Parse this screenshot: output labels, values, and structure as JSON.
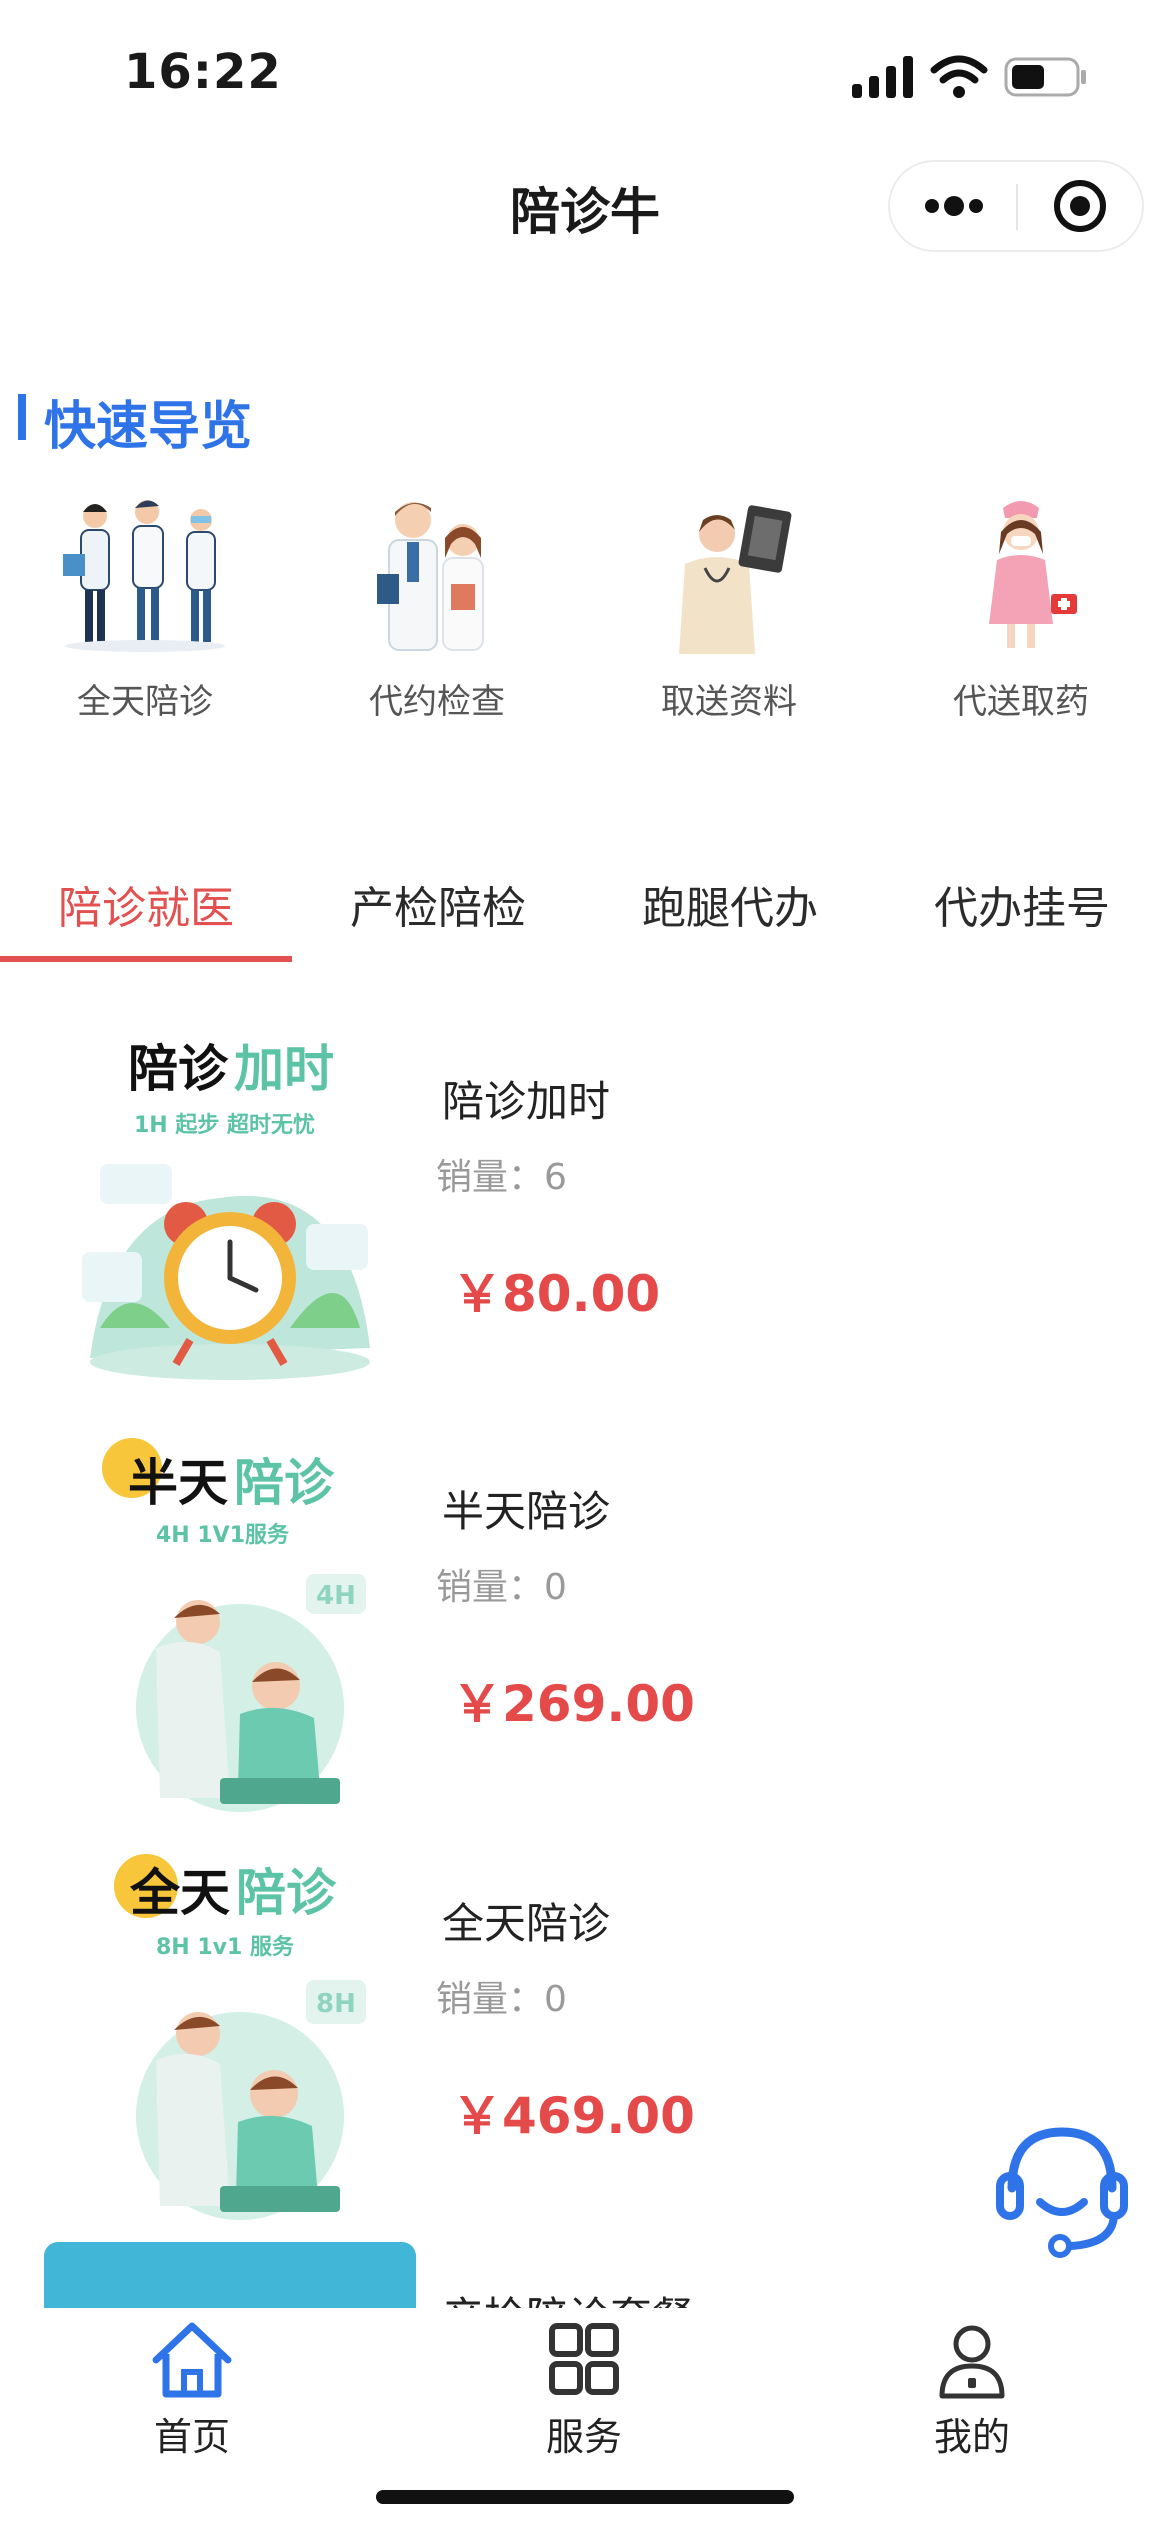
{
  "status": {
    "time": "16:22"
  },
  "nav": {
    "title": "陪诊牛"
  },
  "quick_nav": {
    "title": "快速导览",
    "items": [
      {
        "label": "全天陪诊",
        "icon": "doctors-group-illustration"
      },
      {
        "label": "代约检查",
        "icon": "doctor-nurse-illustration"
      },
      {
        "label": "取送资料",
        "icon": "doctor-xray-illustration"
      },
      {
        "label": "代送取药",
        "icon": "nurse-girl-medkit-illustration"
      }
    ]
  },
  "tabs": {
    "items": [
      {
        "label": "陪诊就医",
        "active": true
      },
      {
        "label": "产检陪检",
        "active": false
      },
      {
        "label": "跑腿代办",
        "active": false
      },
      {
        "label": "代办挂号",
        "active": false
      }
    ]
  },
  "products": [
    {
      "name": "陪诊加时",
      "sales": "销量：6",
      "price": "￥80.00",
      "thumb": {
        "title_a": "陪诊",
        "title_b": "加时",
        "subtitle": "1H 起步 超时无忧",
        "icon": "alarm-clock-illustration"
      }
    },
    {
      "name": "半天陪诊",
      "sales": "销量：0",
      "price": "￥269.00",
      "thumb": {
        "title_a": "半天",
        "title_b": "陪诊",
        "subtitle": "4H 1V1服务",
        "badge": "4H",
        "icon": "nurse-patient-illustration"
      }
    },
    {
      "name": "全天陪诊",
      "sales": "销量：0",
      "price": "￥469.00",
      "thumb": {
        "title_a": "全天",
        "title_b": "陪诊",
        "subtitle": "8H 1v1 服务",
        "badge": "8H",
        "icon": "nurse-patient-illustration"
      }
    }
  ],
  "next_product": {
    "name": "产检陪诊套餐"
  },
  "tabbar": {
    "items": [
      {
        "label": "首页",
        "active": true
      },
      {
        "label": "服务",
        "active": false
      },
      {
        "label": "我的",
        "active": false
      }
    ]
  },
  "colors": {
    "accent": "#2f73e8",
    "tab_active": "#e35050",
    "price": "#e54a4a",
    "teal": "#5cc3a6"
  }
}
